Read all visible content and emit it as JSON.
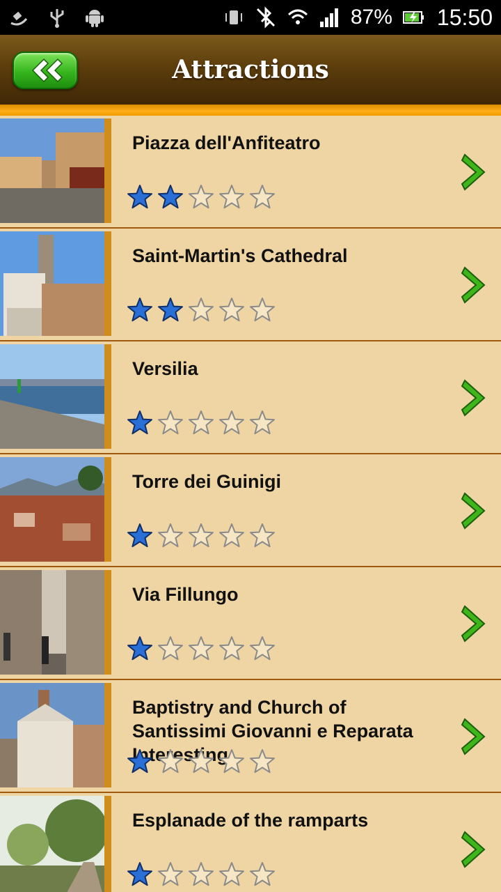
{
  "status_bar": {
    "battery": "87%",
    "time": "15:50",
    "icons": [
      "gps-icon",
      "usb-icon",
      "android-icon",
      "vibrate-icon",
      "bluetooth-off-icon",
      "wifi-icon",
      "signal-icon",
      "battery-icon"
    ]
  },
  "header": {
    "title": "Attractions",
    "back_icon": "double-chevron-left-icon"
  },
  "colors": {
    "row_bg": "#eed5a3",
    "accent_orange": "#ffae1a",
    "header_brown": "#5d3e0c",
    "star_blue": "#2a6fd6",
    "chevron_green": "#3fb51c"
  },
  "attractions": [
    {
      "title": "Piazza dell'Anfiteatro",
      "rating": 2
    },
    {
      "title": "Saint-Martin's Cathedral",
      "rating": 2
    },
    {
      "title": "Versilia",
      "rating": 1
    },
    {
      "title": "Torre dei Guinigi",
      "rating": 1
    },
    {
      "title": "Via Fillungo",
      "rating": 1
    },
    {
      "title": " Baptistry and Church of Santissimi Giovanni e Reparata Interesting",
      "rating": 1
    },
    {
      "title": "Esplanade of the ramparts",
      "rating": 1
    }
  ]
}
